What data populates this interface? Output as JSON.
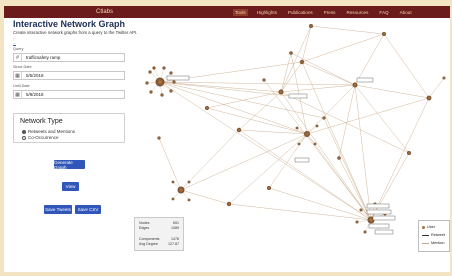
{
  "header": {
    "brand": "Ctlabs",
    "nav": [
      {
        "label": "Tools",
        "active": true
      },
      {
        "label": "Highlights",
        "active": false
      },
      {
        "label": "Publications",
        "active": false
      },
      {
        "label": "Press",
        "active": false
      },
      {
        "label": "Resources",
        "active": false
      },
      {
        "label": "FAQ",
        "active": false
      },
      {
        "label": "About",
        "active": false
      }
    ]
  },
  "page": {
    "title": "Interactive Network Graph",
    "subtitle": "Create interactive network graphs from a query to the Twitter API.",
    "helper_line": "...",
    "links_text": "..."
  },
  "form": {
    "query_label": "Query",
    "query_value": "trafficsafety ramp",
    "since_label": "Since Date",
    "since_value": "5/5/2018",
    "until_label": "Until Date",
    "until_value": "5/9/2018",
    "network_type_label": "Network Type",
    "network_types": [
      {
        "label": "Retweets and Mentions",
        "selected": true
      },
      {
        "label": "Co-Occurrence",
        "selected": false
      }
    ],
    "create_button": "Generate Graph",
    "view_button": "View",
    "export_button_1": "Save Tweets",
    "export_button_2": "Save CSV"
  },
  "stats": {
    "rows": [
      {
        "label": "Nodes",
        "value": "651"
      },
      {
        "label": "Edges",
        "value": "1089"
      },
      {
        "label": "Components",
        "value": "1476"
      },
      {
        "label": "Avg Degree",
        "value": "127.87"
      }
    ]
  },
  "legend": {
    "items": [
      "User",
      "Retweet",
      "Mention"
    ]
  },
  "colors": {
    "header_bg": "#6b1b1b",
    "accent": "#2f56b8",
    "node": "#a77445",
    "edge": "#c8aa8a",
    "title": "#1d2e59"
  }
}
